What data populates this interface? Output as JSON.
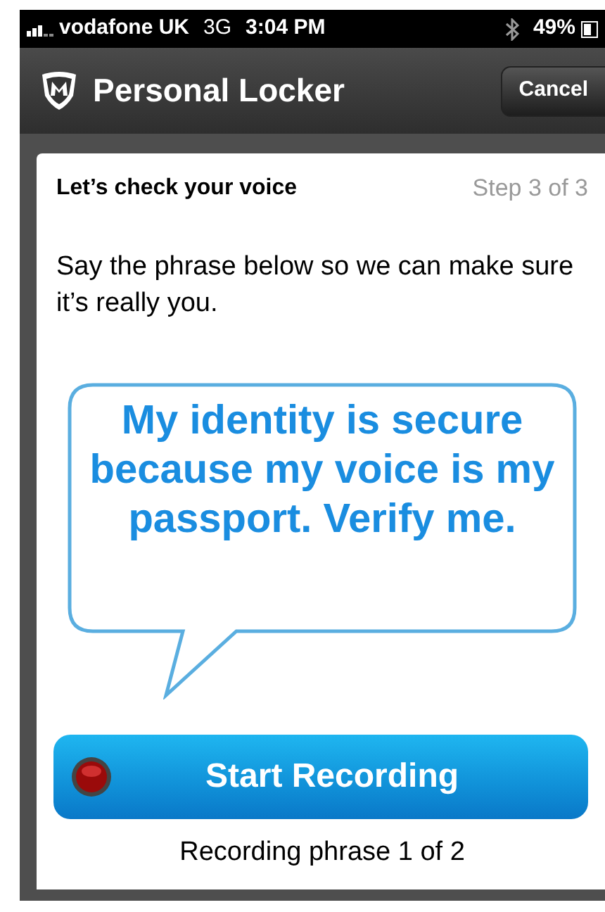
{
  "status_bar": {
    "carrier": "vodafone UK",
    "network": "3G",
    "time": "3:04 PM",
    "battery": "49%"
  },
  "nav_bar": {
    "title": "Personal Locker",
    "cancel": "Cancel"
  },
  "card": {
    "heading": "Let’s check your voice",
    "step": "Step 3 of 3",
    "instruction": "Say the phrase below so we can make sure it’s really you.",
    "phrase": "My identity is secure because my voice is my passport. Verify me.",
    "button": "Start Recording",
    "progress": "Recording phrase 1 of 2"
  }
}
